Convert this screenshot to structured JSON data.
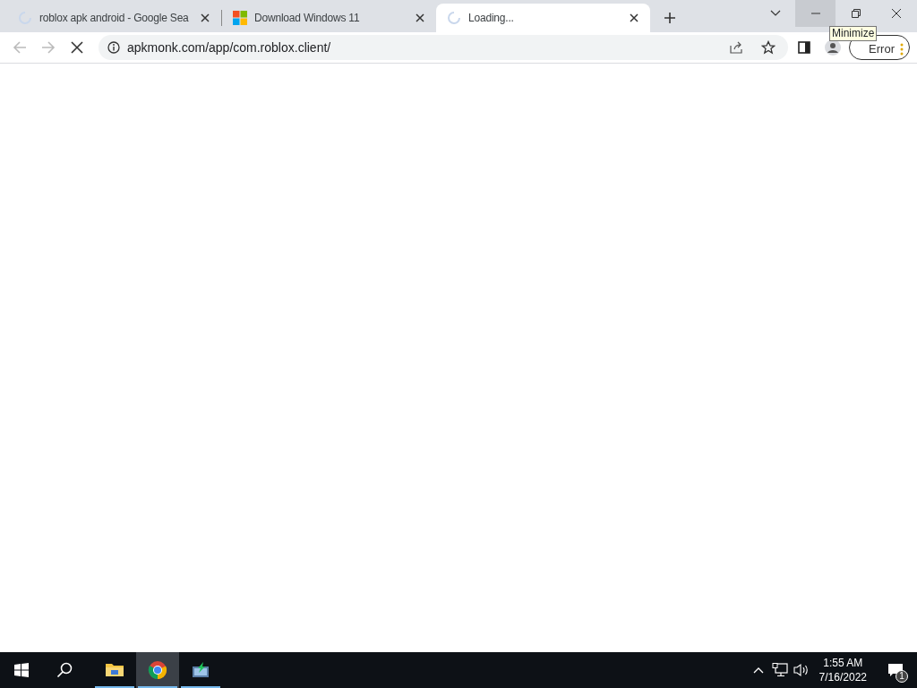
{
  "tabs": [
    {
      "title": "roblox apk android - Google Sea",
      "kind": "loading",
      "selected": false
    },
    {
      "title": "Download Windows 11",
      "kind": "windows",
      "selected": false
    },
    {
      "title": "Loading...",
      "kind": "loading",
      "selected": true
    }
  ],
  "window_controls": [
    {
      "kind": "minimize",
      "hovered": true
    },
    {
      "kind": "restore",
      "hovered": false
    },
    {
      "kind": "close",
      "hovered": false
    }
  ],
  "tooltip": "Minimize",
  "address_bar": {
    "url": "apkmonk.com/app/com.roblox.client/",
    "loading": true
  },
  "profile_button": "Error",
  "taskbar": {
    "apps": [
      {
        "kind": "explorer",
        "selected": false
      },
      {
        "kind": "chrome",
        "selected": true
      },
      {
        "kind": "installer",
        "selected": false
      }
    ],
    "time": "1:55 AM",
    "date": "7/16/2022",
    "notifications": "1"
  }
}
